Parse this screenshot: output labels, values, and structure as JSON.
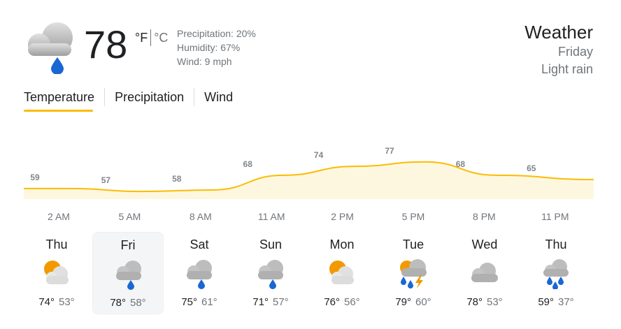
{
  "current": {
    "temperature": "78",
    "unit_f": "°F",
    "unit_c": "°C",
    "precipitation": "Precipitation: 20%",
    "humidity": "Humidity: 67%",
    "wind": "Wind: 9 mph",
    "icon": "light-rain-icon"
  },
  "header": {
    "title": "Weather",
    "day": "Friday",
    "condition": "Light rain"
  },
  "tabs": [
    {
      "label": "Temperature",
      "selected": true
    },
    {
      "label": "Precipitation",
      "selected": false
    },
    {
      "label": "Wind",
      "selected": false
    }
  ],
  "chart_data": {
    "type": "area",
    "x": [
      "2 AM",
      "5 AM",
      "8 AM",
      "11 AM",
      "2 PM",
      "5 PM",
      "8 PM",
      "11 PM"
    ],
    "values": [
      59,
      57,
      58,
      68,
      74,
      77,
      68,
      65
    ],
    "title": "",
    "xlabel": "",
    "ylabel": "",
    "ylim": [
      40,
      95
    ],
    "grid": false,
    "line_color": "#fbbc04",
    "fill_color": "#fef7e0"
  },
  "days": [
    {
      "name": "Thu",
      "hi": "74°",
      "lo": "53°",
      "icon": "partly-cloudy-icon",
      "selected": false
    },
    {
      "name": "Fri",
      "hi": "78°",
      "lo": "58°",
      "icon": "light-rain-icon",
      "selected": true
    },
    {
      "name": "Sat",
      "hi": "75°",
      "lo": "61°",
      "icon": "light-rain-icon",
      "selected": false
    },
    {
      "name": "Sun",
      "hi": "71°",
      "lo": "57°",
      "icon": "light-rain-icon",
      "selected": false
    },
    {
      "name": "Mon",
      "hi": "76°",
      "lo": "56°",
      "icon": "partly-cloudy-icon",
      "selected": false
    },
    {
      "name": "Tue",
      "hi": "79°",
      "lo": "60°",
      "icon": "thunderstorm-icon",
      "selected": false
    },
    {
      "name": "Wed",
      "hi": "78°",
      "lo": "53°",
      "icon": "cloudy-icon",
      "selected": false
    },
    {
      "name": "Thu",
      "hi": "59°",
      "lo": "37°",
      "icon": "rain-icon",
      "selected": false
    }
  ]
}
